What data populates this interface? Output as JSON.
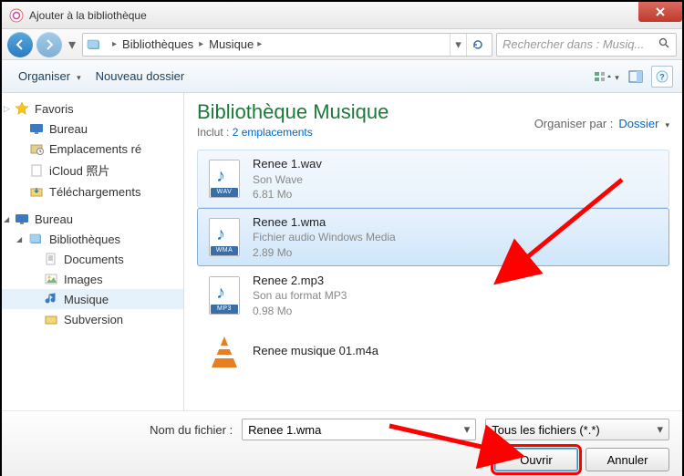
{
  "window": {
    "title": "Ajouter à la bibliothèque"
  },
  "breadcrumb": {
    "root": "Bibliothèques",
    "leaf": "Musique"
  },
  "search": {
    "placeholder": "Rechercher dans : Musiq..."
  },
  "toolbar": {
    "organize": "Organiser",
    "new_folder": "Nouveau dossier"
  },
  "sidebar": {
    "favorites": "Favoris",
    "bureau": "Bureau",
    "emplacements": "Emplacements ré",
    "icloud": "iCloud 照片",
    "telechargements": "Téléchargements",
    "bureau2": "Bureau",
    "bibliotheques": "Bibliothèques",
    "documents": "Documents",
    "images": "Images",
    "musique": "Musique",
    "subversion": "Subversion"
  },
  "main": {
    "title": "Bibliothèque Musique",
    "includes_prefix": "Inclut :",
    "includes_link": "2 emplacements",
    "organize_by": "Organiser par :",
    "organize_val": "Dossier"
  },
  "files": [
    {
      "name": "Renee 1.wav",
      "type": "Son Wave",
      "size": "6.81 Mo",
      "badge": "WAV"
    },
    {
      "name": "Renee 1.wma",
      "type": "Fichier audio Windows Media",
      "size": "2.89 Mo",
      "badge": "WMA"
    },
    {
      "name": "Renee 2.mp3",
      "type": "Son au format MP3",
      "size": "0.98 Mo",
      "badge": "MP3"
    },
    {
      "name": "Renee musique 01.m4a",
      "type": "",
      "size": "",
      "badge": "VLC"
    }
  ],
  "footer": {
    "filename_label": "Nom du fichier :",
    "filename_value": "Renee 1.wma",
    "filter": "Tous les fichiers (*.*)",
    "open": "Ouvrir",
    "cancel": "Annuler"
  }
}
